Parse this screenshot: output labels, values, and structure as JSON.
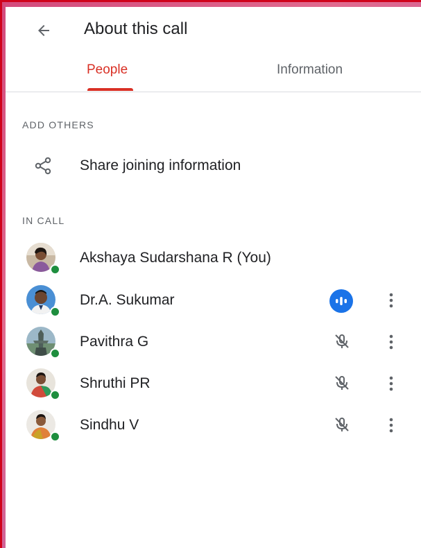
{
  "header": {
    "title": "About this call"
  },
  "tabs": [
    {
      "label": "People",
      "selected": true
    },
    {
      "label": "Information",
      "selected": false
    }
  ],
  "add_others": {
    "section_label": "ADD OTHERS",
    "share_label": "Share joining information"
  },
  "in_call": {
    "section_label": "IN CALL",
    "people": [
      {
        "name": "Akshaya Sudarshana R (You)",
        "status": "self"
      },
      {
        "name": "Dr.A. Sukumar",
        "status": "speaking"
      },
      {
        "name": "Pavithra G",
        "status": "muted"
      },
      {
        "name": "Shruthi PR",
        "status": "muted"
      },
      {
        "name": "Sindhu V",
        "status": "muted"
      }
    ]
  },
  "colors": {
    "accent": "#d93025",
    "presence": "#1e8e3e",
    "speaking": "#1a73e8"
  }
}
